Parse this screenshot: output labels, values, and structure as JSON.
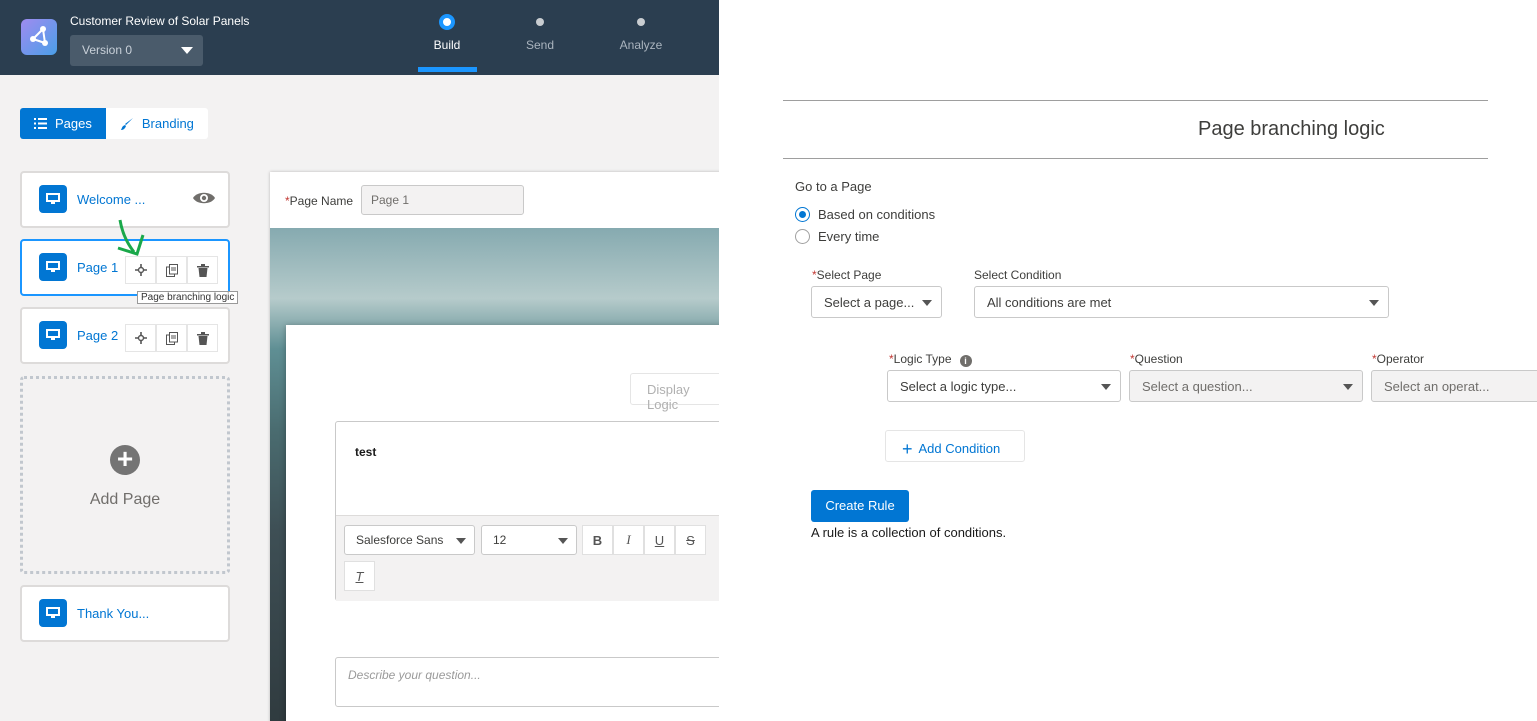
{
  "app": {
    "survey_title": "Customer Review of Solar Panels",
    "version": "Version 0",
    "steps": [
      {
        "label": "Build",
        "active": true
      },
      {
        "label": "Send",
        "active": false
      },
      {
        "label": "Analyze",
        "active": false
      }
    ]
  },
  "left_panel": {
    "toggle": {
      "pages": "Pages",
      "branding": "Branding"
    },
    "pages": [
      {
        "label": "Welcome ..."
      },
      {
        "label": "Page 1"
      },
      {
        "label": "Page 2"
      },
      {
        "label": "Thank You..."
      }
    ],
    "tooltip": "Page branching logic",
    "add_page": "Add Page"
  },
  "editor": {
    "page_name_label": "Page Name",
    "page_name_value": "Page 1",
    "display_logic": "Display Logic",
    "question_text": "test",
    "font_family": "Salesforce Sans",
    "font_size": "12",
    "describe_placeholder": "Describe your question..."
  },
  "branching": {
    "title": "Page branching logic",
    "go_to_label": "Go to a Page",
    "radio_options": [
      {
        "label": "Based on conditions",
        "checked": true
      },
      {
        "label": "Every time",
        "checked": false
      }
    ],
    "select_page_label": "Select Page",
    "select_page_value": "Select a page...",
    "select_condition_label": "Select Condition",
    "select_condition_value": "All conditions are met",
    "logic_type_label": "Logic Type",
    "logic_type_value": "Select a logic type...",
    "question_label": "Question",
    "question_value": "Select a question...",
    "operator_label": "Operator",
    "operator_value": "Select an operat...",
    "add_condition": "Add Condition",
    "create_rule": "Create Rule",
    "rule_note": "A rule is a collection of conditions."
  },
  "colors": {
    "brand_blue": "#0176d3",
    "header_bg": "#2b3e50",
    "required": "#c23934",
    "annotation_arrow": "#1aa84a"
  }
}
